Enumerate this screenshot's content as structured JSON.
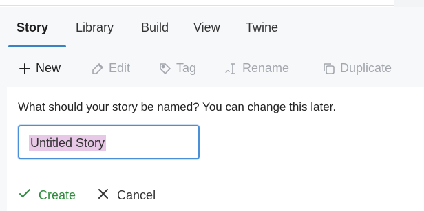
{
  "tabs": [
    {
      "label": "Story"
    },
    {
      "label": "Library"
    },
    {
      "label": "Build"
    },
    {
      "label": "View"
    },
    {
      "label": "Twine"
    }
  ],
  "toolbar": {
    "new_label": "New",
    "edit_label": "Edit",
    "tag_label": "Tag",
    "rename_label": "Rename",
    "duplicate_label": "Duplicate"
  },
  "dialog": {
    "prompt": "What should your story be named? You can change this later.",
    "input_value": "Untitled Story",
    "create_label": "Create",
    "cancel_label": "Cancel"
  },
  "colors": {
    "accent": "#3b82c4",
    "create": "#2e8b3d",
    "selection": "#e7c8e6",
    "disabled": "#a3a7ad"
  },
  "icons": {
    "new": "plus-icon",
    "edit": "pencil-icon",
    "tag": "tag-icon",
    "rename": "rename-icon",
    "duplicate": "duplicate-icon",
    "create": "checkmark-icon",
    "cancel": "x-icon"
  }
}
